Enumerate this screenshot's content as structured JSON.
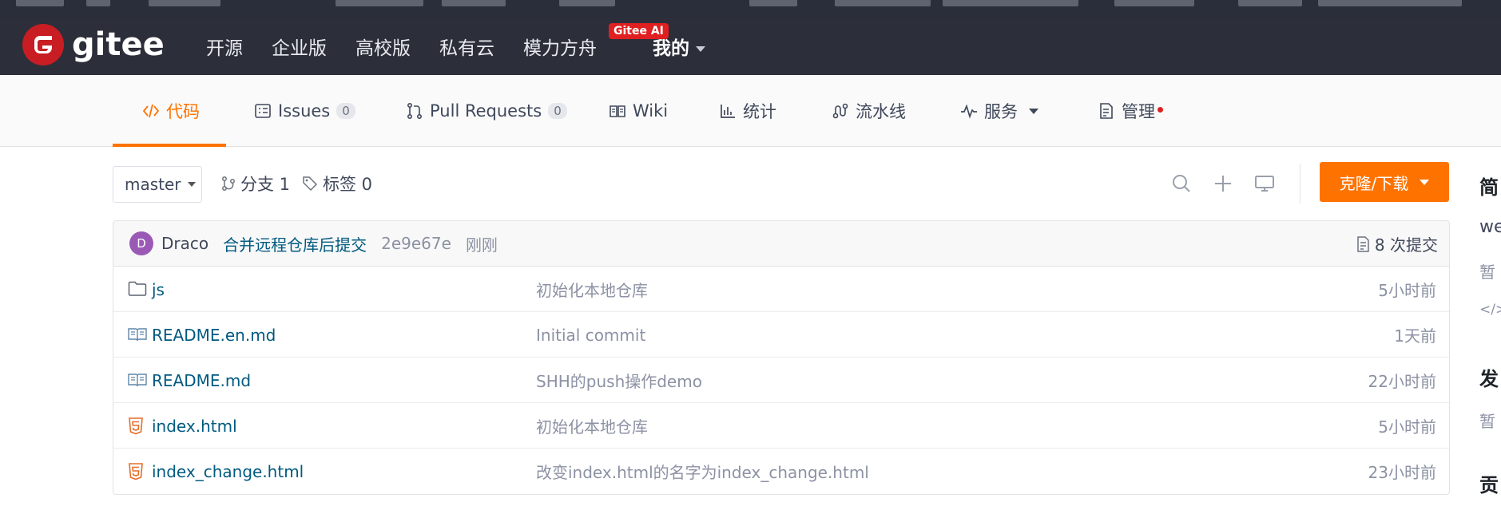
{
  "header": {
    "logo_text": "gitee",
    "nav": [
      "开源",
      "企业版",
      "高校版",
      "私有云",
      "模力方舟",
      "我的"
    ],
    "ai_badge": "Gitee AI"
  },
  "tabs": [
    {
      "label": "代码",
      "icon": "code-icon",
      "active": true
    },
    {
      "label": "Issues",
      "icon": "issues-icon",
      "count": "0"
    },
    {
      "label": "Pull Requests",
      "icon": "pull-request-icon",
      "count": "0"
    },
    {
      "label": "Wiki",
      "icon": "wiki-book-icon"
    },
    {
      "label": "统计",
      "icon": "stats-icon"
    },
    {
      "label": "流水线",
      "icon": "pipeline-icon"
    },
    {
      "label": "服务",
      "icon": "pulse-icon"
    },
    {
      "label": "管理",
      "icon": "manage-icon"
    }
  ],
  "branch": {
    "current": "master",
    "branches_label": "分支 1",
    "tags_label": "标签 0"
  },
  "clone_button": "克隆/下载",
  "commit": {
    "avatar_letter": "D",
    "author": "Draco",
    "message": "合并远程仓库后提交",
    "hash": "2e9e67e",
    "time": "刚刚",
    "count_label": "8 次提交"
  },
  "files": [
    {
      "name": "js",
      "type": "folder",
      "message": "初始化本地仓库",
      "time": "5小时前"
    },
    {
      "name": "README.en.md",
      "type": "markdown",
      "message": "Initial commit",
      "time": "1天前"
    },
    {
      "name": "README.md",
      "type": "markdown",
      "message": "SHH的push操作demo",
      "time": "22小时前"
    },
    {
      "name": "index.html",
      "type": "html",
      "message": "初始化本地仓库",
      "time": "5小时前"
    },
    {
      "name": "index_change.html",
      "type": "html",
      "message": "改变index.html的名字为index_change.html",
      "time": "23小时前"
    }
  ],
  "sidebar": {
    "intro_heading": "简",
    "intro_text": "we",
    "intro_none": "暂",
    "code_icon": "</>",
    "release_heading": "发",
    "release_none": "暂",
    "contrib_heading": "贡"
  },
  "colors": {
    "accent": "#fe7300",
    "header_bg": "#2c2f3a",
    "link": "#005980",
    "badge_red": "#e02020"
  }
}
